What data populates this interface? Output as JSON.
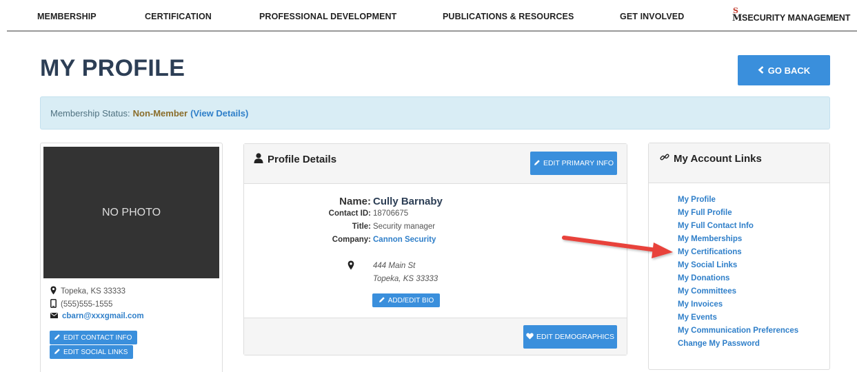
{
  "nav": {
    "items": [
      "MEMBERSHIP",
      "CERTIFICATION",
      "PROFESSIONAL DEVELOPMENT",
      "PUBLICATIONS & RESOURCES",
      "GET INVOLVED"
    ],
    "brand_logo_s": "S",
    "brand_logo_m": "M",
    "brand": "SECURITY MANAGEMENT"
  },
  "header": {
    "title": "MY PROFILE",
    "go_back": "GO BACK"
  },
  "banner": {
    "label": "Membership Status:",
    "status": "Non-Member",
    "view_details": "(View Details)"
  },
  "left_card": {
    "photo_placeholder": "NO PHOTO",
    "location": "Topeka, KS 33333",
    "phone": "(555)555-1555",
    "email": "cbarn@xxxgmail.com",
    "edit_contact": "EDIT CONTACT INFO",
    "edit_social": "EDIT SOCIAL LINKS"
  },
  "details": {
    "title": "Profile Details",
    "edit_primary": "EDIT PRIMARY INFO",
    "name_label": "Name:",
    "name": "Cully Barnaby",
    "contact_id_label": "Contact ID:",
    "contact_id": "18706675",
    "title_label": "Title:",
    "job_title": "Security manager",
    "company_label": "Company:",
    "company": "Cannon Security",
    "address_line1": "444 Main St",
    "address_line2": "Topeka, KS 33333",
    "add_bio": "ADD/EDIT BIO",
    "edit_demographics": "EDIT DEMOGRAPHICS"
  },
  "links": {
    "title": "My Account Links",
    "items": [
      "My Profile",
      "My Full Profile",
      "My Full Contact Info",
      "My Memberships",
      "My Certifications",
      "My Social Links",
      "My Donations",
      "My Committees",
      "My Invoices",
      "My Events",
      "My Communication Preferences",
      "Change My Password"
    ]
  },
  "colors": {
    "primary_button": "#3a8fdc",
    "link": "#2f7fc9",
    "banner_bg": "#d9edf5",
    "title": "#2c3e55",
    "annotation_arrow": "#e8423a"
  }
}
